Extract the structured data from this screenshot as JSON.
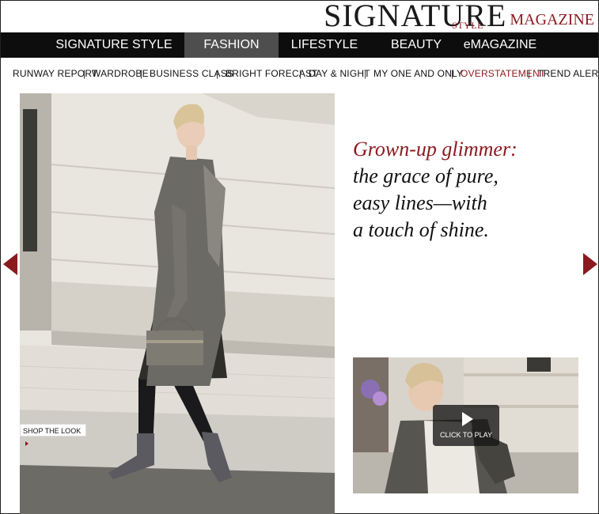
{
  "brand": {
    "name": "SIGNATURE",
    "style_word": "STYLE",
    "magazine_word": "MAGAZINE",
    "accent_color": "#8b1a1f"
  },
  "main_nav": {
    "items": [
      {
        "label": "SIGNATURE STYLE",
        "active": false
      },
      {
        "label": "FASHION",
        "active": true
      },
      {
        "label": "LIFESTYLE",
        "active": false
      },
      {
        "label": "BEAUTY",
        "active": false
      },
      {
        "label": "eMAGAZINE",
        "active": false
      }
    ]
  },
  "sub_nav": {
    "separator": "|",
    "items": [
      {
        "label": "RUNWAY REPORT",
        "active": false
      },
      {
        "label": "WARDROBE",
        "active": false
      },
      {
        "label": "BUSINESS CLASS",
        "active": false
      },
      {
        "label": "BRIGHT FORECAST",
        "active": false
      },
      {
        "label": "DAY & NIGHT",
        "active": false
      },
      {
        "label": "MY ONE AND ONLY",
        "active": false
      },
      {
        "label": "OVERSTATEMENT",
        "active": true
      },
      {
        "label": "TREND ALERT",
        "active": false
      }
    ]
  },
  "hero": {
    "shop_label": "SHOP THE LOOK"
  },
  "headline": {
    "accent": "Grown-up glimmer:",
    "lines": [
      "the grace of pure,",
      "easy lines—with",
      "a touch of shine."
    ]
  },
  "video": {
    "play_label": "CLICK TO PLAY"
  },
  "icons": {
    "prev": "arrow-left-icon",
    "next": "arrow-right-icon",
    "play": "play-icon"
  }
}
